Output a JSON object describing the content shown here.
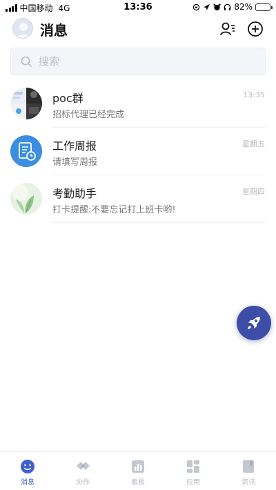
{
  "status_bar": {
    "carrier": "中国移动",
    "network": "4G",
    "time": "13:36",
    "battery": "82%",
    "battery_level": 0.82
  },
  "header": {
    "title": "消息"
  },
  "search": {
    "placeholder": "搜索"
  },
  "conversations": [
    {
      "name": "poc群",
      "preview": "招标代理已经完成",
      "time": "13:35",
      "avatar": "group-collage"
    },
    {
      "name": "工作周报",
      "preview": "请填写周报",
      "time": "星期五",
      "avatar": "report-icon"
    },
    {
      "name": "考勤助手",
      "preview": "打卡提醒:不要忘记打上班卡哟!",
      "time": "星期四",
      "avatar": "leaf-image"
    }
  ],
  "tabs": [
    {
      "label": "消息",
      "icon": "message-smile-icon",
      "active": true
    },
    {
      "label": "协作",
      "icon": "collaborate-icon",
      "active": false
    },
    {
      "label": "看板",
      "icon": "chart-board-icon",
      "active": false
    },
    {
      "label": "应用",
      "icon": "apps-grid-icon",
      "active": false
    },
    {
      "label": "资讯",
      "icon": "news-book-icon",
      "active": false
    }
  ],
  "colors": {
    "accent": "#4060d0",
    "fab": "#3d4ea8",
    "report_avatar": "#3b8ee0",
    "tab_inactive": "#b7bcc4"
  }
}
